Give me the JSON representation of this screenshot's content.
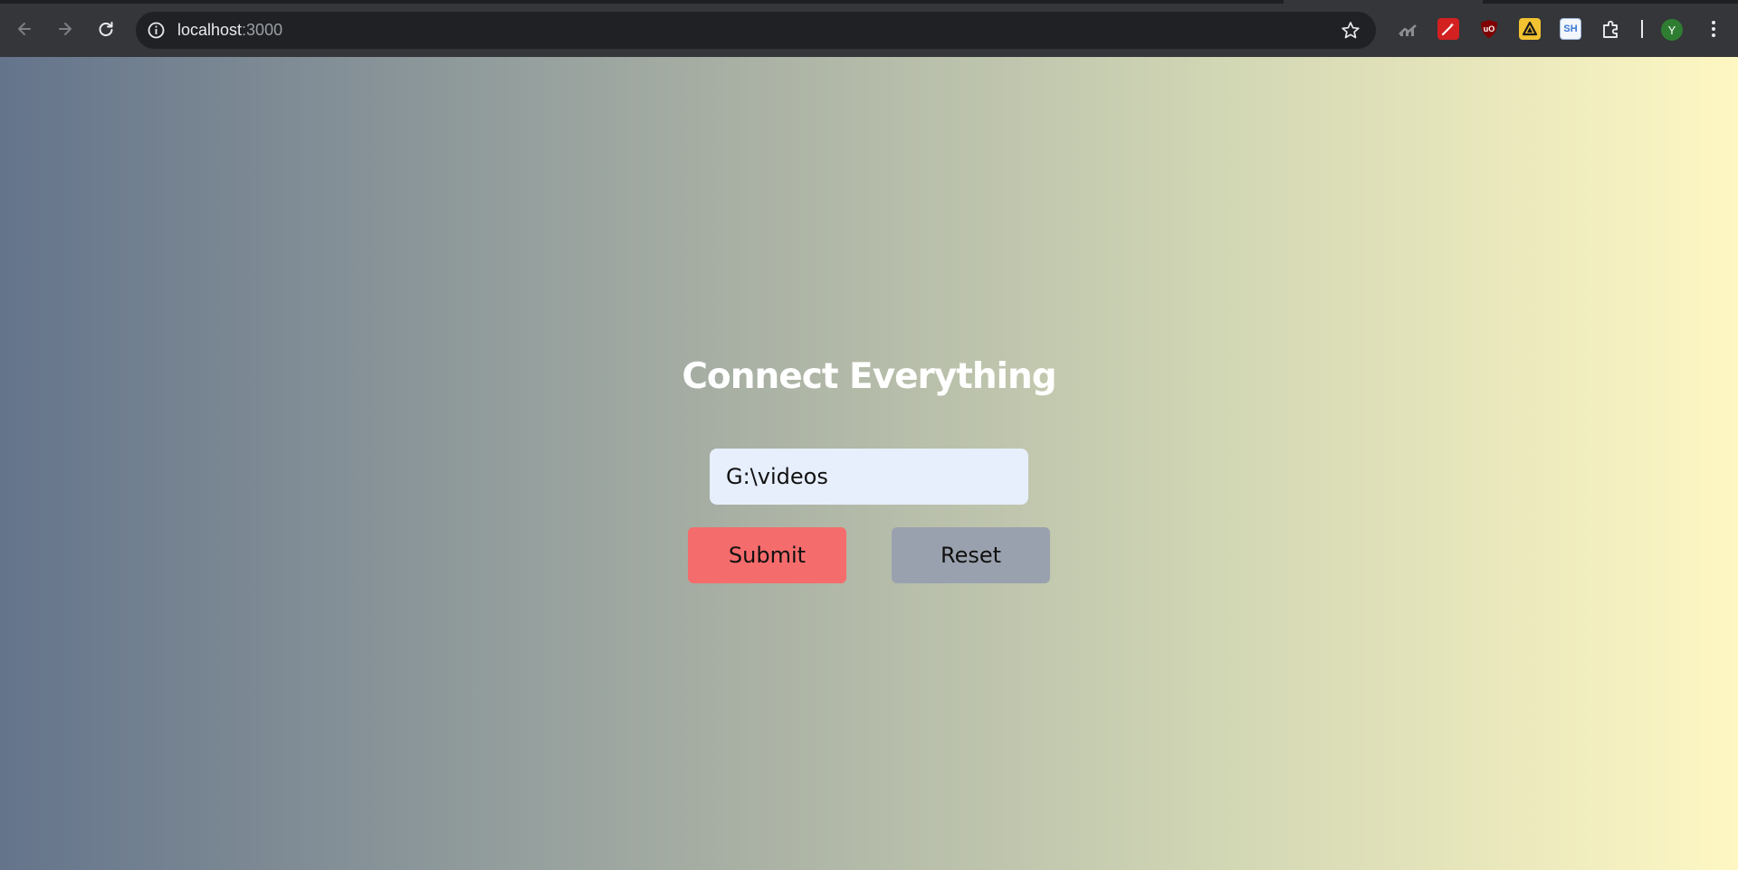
{
  "browser": {
    "address_bar": {
      "host": "localhost",
      "port": ":3000"
    },
    "icons": {
      "back": "arrow-left-icon",
      "forward": "arrow-right-icon",
      "reload": "reload-icon",
      "site_info": "info-icon",
      "bookmark": "star-icon",
      "menu": "more-vert-icon"
    },
    "extensions": [
      {
        "name": "chart-extension-icon",
        "label": ""
      },
      {
        "name": "magic-wand-extension-icon",
        "label": ""
      },
      {
        "name": "ublock-extension-icon",
        "label": "uO"
      },
      {
        "name": "triangle-extension-icon",
        "label": ""
      },
      {
        "name": "sh-extension-icon",
        "label": "SH"
      },
      {
        "name": "puzzle-extensions-icon",
        "label": ""
      }
    ],
    "profile_initial": "Y"
  },
  "page": {
    "title": "Connect Everything",
    "path_input": {
      "value": "G:\\videos"
    },
    "buttons": {
      "submit": "Submit",
      "reset": "Reset"
    },
    "colors": {
      "gradient_start": "#64748b",
      "gradient_end": "#fef7c3",
      "submit_bg": "#f56c6c",
      "reset_bg": "#9aa1ae",
      "input_bg": "#e7effd"
    }
  }
}
